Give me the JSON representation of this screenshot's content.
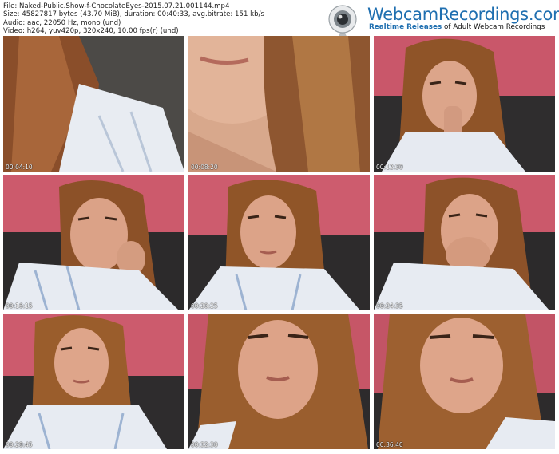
{
  "meta": {
    "file": "File: Naked-Public.Show-f-ChocolateEyes-2015.07.21.001144.mp4",
    "size": "Size: 45827817 bytes (43.70 MiB), duration: 00:40:33, avg.bitrate: 151 kb/s",
    "audio": "Audio: aac, 22050 Hz, mono (und)",
    "video": "Video: h264, yuv420p, 320x240, 10.00 fps(r) (und)"
  },
  "logo": {
    "title": "WebcamRecordings.com",
    "tagline_strong": "Realtime Releases",
    "tagline_rest": " of Adult Webcam Recordings",
    "colors": {
      "brand": "#1f6fb0"
    },
    "icon": "webcam-icon"
  },
  "thumbnails": [
    {
      "timestamp": "00:04:10"
    },
    {
      "timestamp": "00:08:20"
    },
    {
      "timestamp": "00:12:30"
    },
    {
      "timestamp": "00:16:15"
    },
    {
      "timestamp": "00:20:25"
    },
    {
      "timestamp": "00:24:35"
    },
    {
      "timestamp": "00:28:45"
    },
    {
      "timestamp": "00:32:30"
    },
    {
      "timestamp": "00:36:40"
    }
  ]
}
